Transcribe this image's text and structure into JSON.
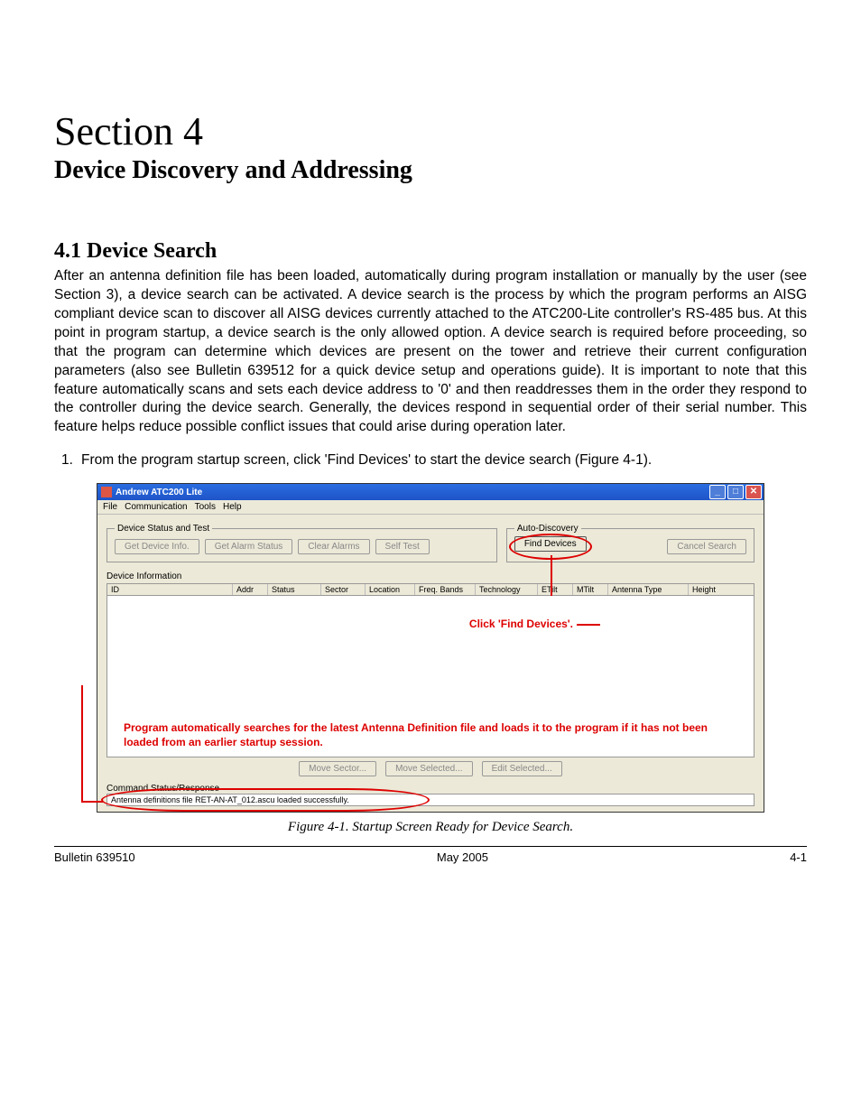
{
  "section": {
    "number": "Section 4",
    "title": "Device Discovery and Addressing"
  },
  "subsection": {
    "heading": "4.1 Device Search",
    "paragraph": "After an antenna definition file has been loaded, automatically during program installation or manually by the user (see Section 3), a device search can be activated. A device search is the process by which the program performs an AISG compliant device scan to discover all AISG devices currently attached to the ATC200-Lite controller's RS-485 bus. At this point in program startup, a device search is the only allowed option. A device search is required before proceeding, so that the program can determine which devices are present on the tower and retrieve their current configuration parameters (also see Bulletin 639512 for a quick device setup and operations guide). It is important to note that this feature automatically scans and sets each device address to '0' and then readdresses them in the order they respond to the controller during the device search. Generally, the devices respond in sequential order of their serial number. This feature helps reduce possible conflict issues that could arise during operation later."
  },
  "step": {
    "number": "1.",
    "text": "From the program startup screen, click 'Find Devices' to start the device search (Figure 4-1)."
  },
  "app": {
    "title": "Andrew ATC200 Lite",
    "menu": [
      "File",
      "Communication",
      "Tools",
      "Help"
    ],
    "groups": {
      "status_test": "Device Status and Test",
      "auto_discovery": "Auto-Discovery",
      "device_info": "Device Information",
      "cmd_status": "Command Status/Response"
    },
    "buttons": {
      "get_device_info": "Get Device Info.",
      "get_alarm_status": "Get Alarm Status",
      "clear_alarms": "Clear Alarms",
      "self_test": "Self Test",
      "find_devices": "Find Devices",
      "cancel_search": "Cancel Search",
      "move_sector": "Move Sector...",
      "move_selected": "Move Selected...",
      "edit_selected": "Edit Selected..."
    },
    "columns": [
      "ID",
      "Addr",
      "Status",
      "Sector",
      "Location",
      "Freq. Bands",
      "Technology",
      "ETilt",
      "MTilt",
      "Antenna Type",
      "Height"
    ],
    "status_text": "Antenna definitions file RET-AN-AT_012.ascu loaded successfully."
  },
  "callouts": {
    "click": "Click 'Find Devices'.",
    "auto": "Program automatically searches for the latest Antenna Definition file and loads it to the program if it has not been loaded from an earlier startup session."
  },
  "figure_caption": "Figure 4-1. Startup Screen Ready for Device Search.",
  "footer": {
    "left": "Bulletin 639510",
    "center": "May 2005",
    "right": "4-1"
  }
}
